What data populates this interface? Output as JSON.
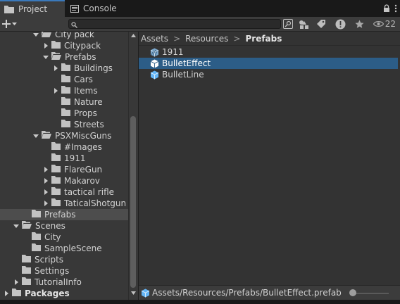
{
  "tabs": {
    "project_label": "Project",
    "console_label": "Console"
  },
  "toolbar": {
    "search_placeholder": "",
    "visibility_count": "22"
  },
  "tree": [
    {
      "label": "City pack",
      "depth": 3,
      "arrow": "open"
    },
    {
      "label": "Citypack",
      "depth": 4,
      "arrow": "closed"
    },
    {
      "label": "Prefabs",
      "depth": 4,
      "arrow": "open"
    },
    {
      "label": "Buildings",
      "depth": 5,
      "arrow": "closed"
    },
    {
      "label": "Cars",
      "depth": 5,
      "arrow": "none"
    },
    {
      "label": "Items",
      "depth": 5,
      "arrow": "closed"
    },
    {
      "label": "Nature",
      "depth": 5,
      "arrow": "none"
    },
    {
      "label": "Props",
      "depth": 5,
      "arrow": "none"
    },
    {
      "label": "Streets",
      "depth": 5,
      "arrow": "none"
    },
    {
      "label": "PSXMiscGuns",
      "depth": 3,
      "arrow": "open"
    },
    {
      "label": "#Images",
      "depth": 4,
      "arrow": "none"
    },
    {
      "label": "1911",
      "depth": 4,
      "arrow": "none"
    },
    {
      "label": "FlareGun",
      "depth": 4,
      "arrow": "closed"
    },
    {
      "label": "Makarov",
      "depth": 4,
      "arrow": "closed"
    },
    {
      "label": "tactical rifle",
      "depth": 4,
      "arrow": "closed"
    },
    {
      "label": "TaticalShotgun",
      "depth": 4,
      "arrow": "closed"
    },
    {
      "label": "Prefabs",
      "depth": 2,
      "arrow": "none",
      "selected": true
    },
    {
      "label": "Scenes",
      "depth": 1,
      "arrow": "open"
    },
    {
      "label": "City",
      "depth": 2,
      "arrow": "none"
    },
    {
      "label": "SampleScene",
      "depth": 2,
      "arrow": "none"
    },
    {
      "label": "Scripts",
      "depth": 1,
      "arrow": "none"
    },
    {
      "label": "Settings",
      "depth": 1,
      "arrow": "none"
    },
    {
      "label": "TutorialInfo",
      "depth": 1,
      "arrow": "closed"
    },
    {
      "label": "Packages",
      "depth": 0,
      "arrow": "closed",
      "bold": true
    }
  ],
  "breadcrumb": [
    {
      "label": "Assets"
    },
    {
      "label": "Resources"
    },
    {
      "label": "Prefabs"
    }
  ],
  "breadcrumb_sep": ">",
  "assets": [
    {
      "label": "1911",
      "icon": "prefab-variant-icon",
      "selected": false
    },
    {
      "label": "BulletEffect",
      "icon": "prefab-icon",
      "selected": true
    },
    {
      "label": "BulletLine",
      "icon": "prefab-icon",
      "selected": false
    }
  ],
  "status": {
    "path": "Assets/Resources/Prefabs/BulletEffect.prefab"
  },
  "colors": {
    "accent": "#3a79bb",
    "selection": "#2c5d87",
    "prefab_blue": "#64b5f6"
  }
}
